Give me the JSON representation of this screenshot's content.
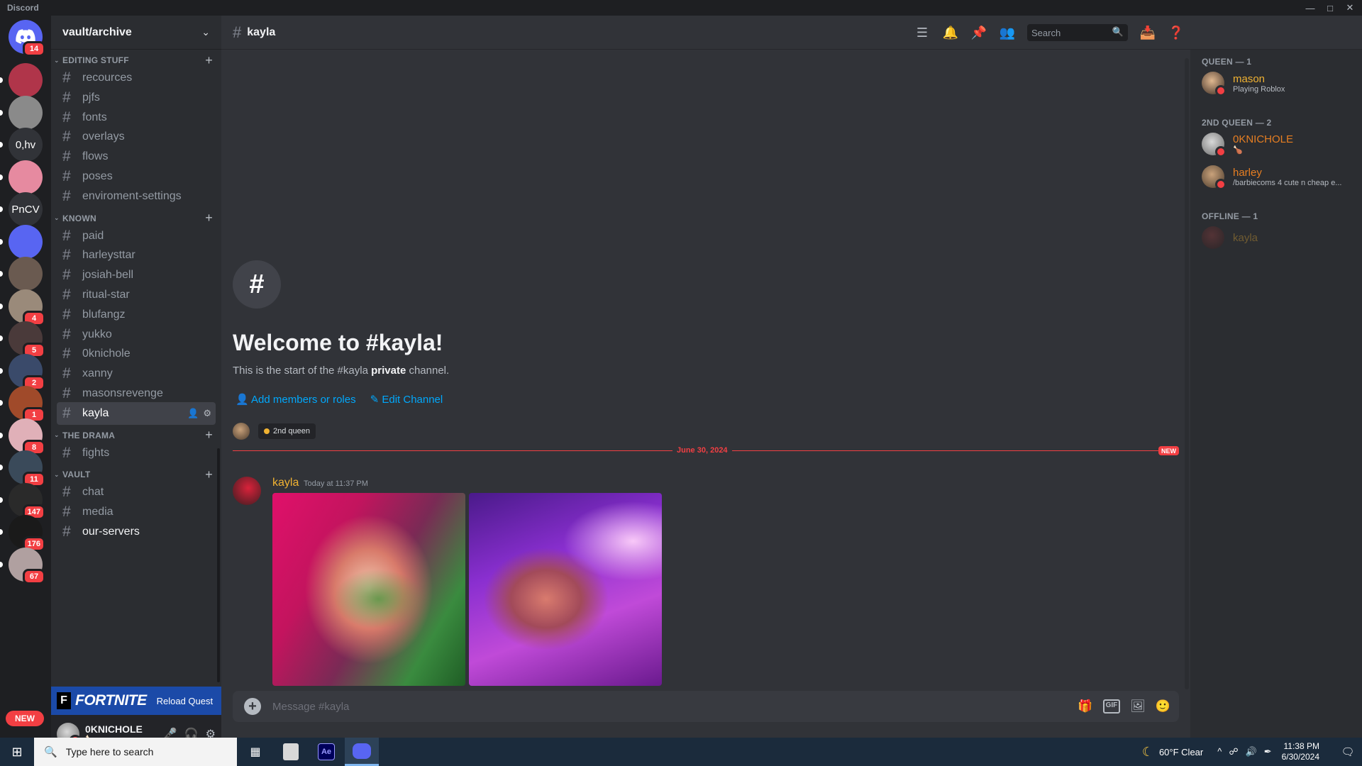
{
  "window": {
    "title": "Discord"
  },
  "guilds": {
    "home_badge": "14",
    "items": [
      {
        "label": "",
        "badge": "",
        "color": "#b0354a"
      },
      {
        "label": "",
        "badge": "",
        "color": "#8a8a8a"
      },
      {
        "label": "0,hv",
        "badge": "",
        "color": "#313338"
      },
      {
        "label": "",
        "badge": "",
        "color": "#e68aa0"
      },
      {
        "label": "PnCV",
        "badge": "",
        "color": "#313338"
      },
      {
        "label": "",
        "badge": "",
        "color": "#5865f2"
      },
      {
        "label": "",
        "badge": "",
        "color": "#6a5a50"
      },
      {
        "label": "",
        "badge": "4",
        "color": "#9a8a7a"
      },
      {
        "label": "",
        "badge": "5",
        "color": "#4a3a3a"
      },
      {
        "label": "",
        "badge": "2",
        "color": "#3a4a6a"
      },
      {
        "label": "",
        "badge": "1",
        "color": "#a04a2a"
      },
      {
        "label": "",
        "badge": "8",
        "color": "#e0b0b8"
      },
      {
        "label": "",
        "badge": "11",
        "color": "#3a4a5a"
      },
      {
        "label": "",
        "badge": "147",
        "color": "#2a2a2a"
      },
      {
        "label": "",
        "badge": "176",
        "color": "#1a1a1a"
      },
      {
        "label": "",
        "badge": "67",
        "color": "#b0a0a0"
      }
    ],
    "new_label": "NEW"
  },
  "server": {
    "name": "vault/archive",
    "categories": [
      {
        "name": "EDITING STUFF",
        "channels": [
          "recources",
          "pjfs",
          "fonts",
          "overlays",
          "flows",
          "poses",
          "enviroment-settings"
        ]
      },
      {
        "name": "KNOWN",
        "channels": [
          "paid",
          "harleysttar",
          "josiah-bell",
          "ritual-star",
          "blufangz",
          "yukko",
          "0knichole",
          "xanny",
          "masonsrevenge",
          "kayla"
        ]
      },
      {
        "name": "THE DRAMA",
        "channels": [
          "fights"
        ]
      },
      {
        "name": "VAULT",
        "channels": [
          "chat",
          "media",
          "our-servers"
        ]
      }
    ]
  },
  "quest": {
    "game": "FORTNITE",
    "logo_letter": "F",
    "action": "Reload Quest"
  },
  "user": {
    "name": "0KNICHOLE",
    "status_emoji": "🍗"
  },
  "channel": {
    "name": "kayla",
    "search_placeholder": "Search",
    "welcome_title": "Welcome to #kayla!",
    "welcome_sub_prefix": "This is the start of the #kayla ",
    "welcome_sub_bold": "private",
    "welcome_sub_suffix": " channel.",
    "add_members": "Add members or roles",
    "edit_channel": "Edit Channel",
    "role_tag": "2nd queen",
    "divider_date": "June 30, 2024",
    "new_tag": "NEW",
    "composer_placeholder": "Message #kayla",
    "gif_label": "GIF"
  },
  "message": {
    "author": "kayla",
    "timestamp": "Today at 11:37 PM"
  },
  "members": {
    "groups": [
      {
        "title": "QUEEN — 1",
        "members": [
          {
            "name": "mason",
            "activity": "Playing Roblox",
            "color": "#f0b232"
          }
        ]
      },
      {
        "title": "2ND QUEEN — 2",
        "members": [
          {
            "name": "0KNICHOLE",
            "activity": "🍗",
            "color": "#e67e22"
          },
          {
            "name": "harley",
            "activity": "/barbiecoms 4 cute n cheap e...",
            "color": "#e67e22"
          }
        ]
      },
      {
        "title": "OFFLINE — 1",
        "members": [
          {
            "name": "kayla",
            "activity": "",
            "color": "#f0b232"
          }
        ]
      }
    ]
  },
  "taskbar": {
    "search_placeholder": "Type here to search",
    "weather": "60°F  Clear",
    "time": "11:38 PM",
    "date": "6/30/2024",
    "ae_label": "Ae"
  }
}
